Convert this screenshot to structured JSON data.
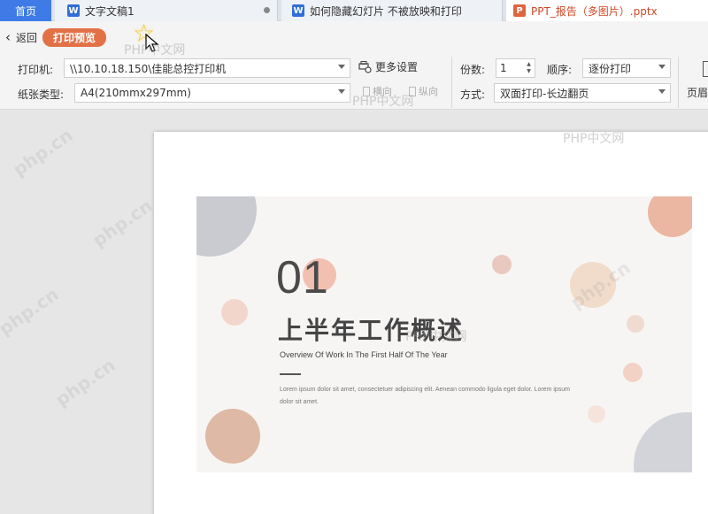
{
  "tabs": {
    "home": "首页",
    "doc1": "文字文稿1",
    "doc2": "如何隐藏幻灯片 不被放映和打印",
    "ppt": "PPT_报告（多图片）.pptx"
  },
  "subbar": {
    "back": "返回",
    "preview": "打印预览"
  },
  "settings": {
    "printer_label": "打印机:",
    "printer_value": "\\\\10.10.18.150\\佳能总控打印机",
    "more_settings": "更多设置",
    "paper_label": "纸张类型:",
    "paper_value": "A4(210mmx297mm)",
    "landscape": "横向",
    "portrait": "纵向",
    "copies_label": "份数:",
    "copies_value": "1",
    "order_label": "顺序:",
    "order_value": "逐份打印",
    "mode_label": "方式:",
    "mode_value": "双面打印-长边翻页",
    "header_footer": "页眉"
  },
  "slide": {
    "number": "01",
    "title": "上半年工作概述",
    "subtitle": "Overview Of Work In The First Half Of The Year",
    "body": "Lorem ipsum dolor sit amet, consectetuer adipiscing elit. Aenean commodo ligula eget dolor. Lorem ipsum dolor sit amet."
  },
  "watermark": {
    "brand": "php.cn",
    "cn": "PHP中文网"
  },
  "colors": {
    "accent_tab": "#3e7be6",
    "preview_pill": "#e37148",
    "ppt_orange": "#d24726"
  }
}
